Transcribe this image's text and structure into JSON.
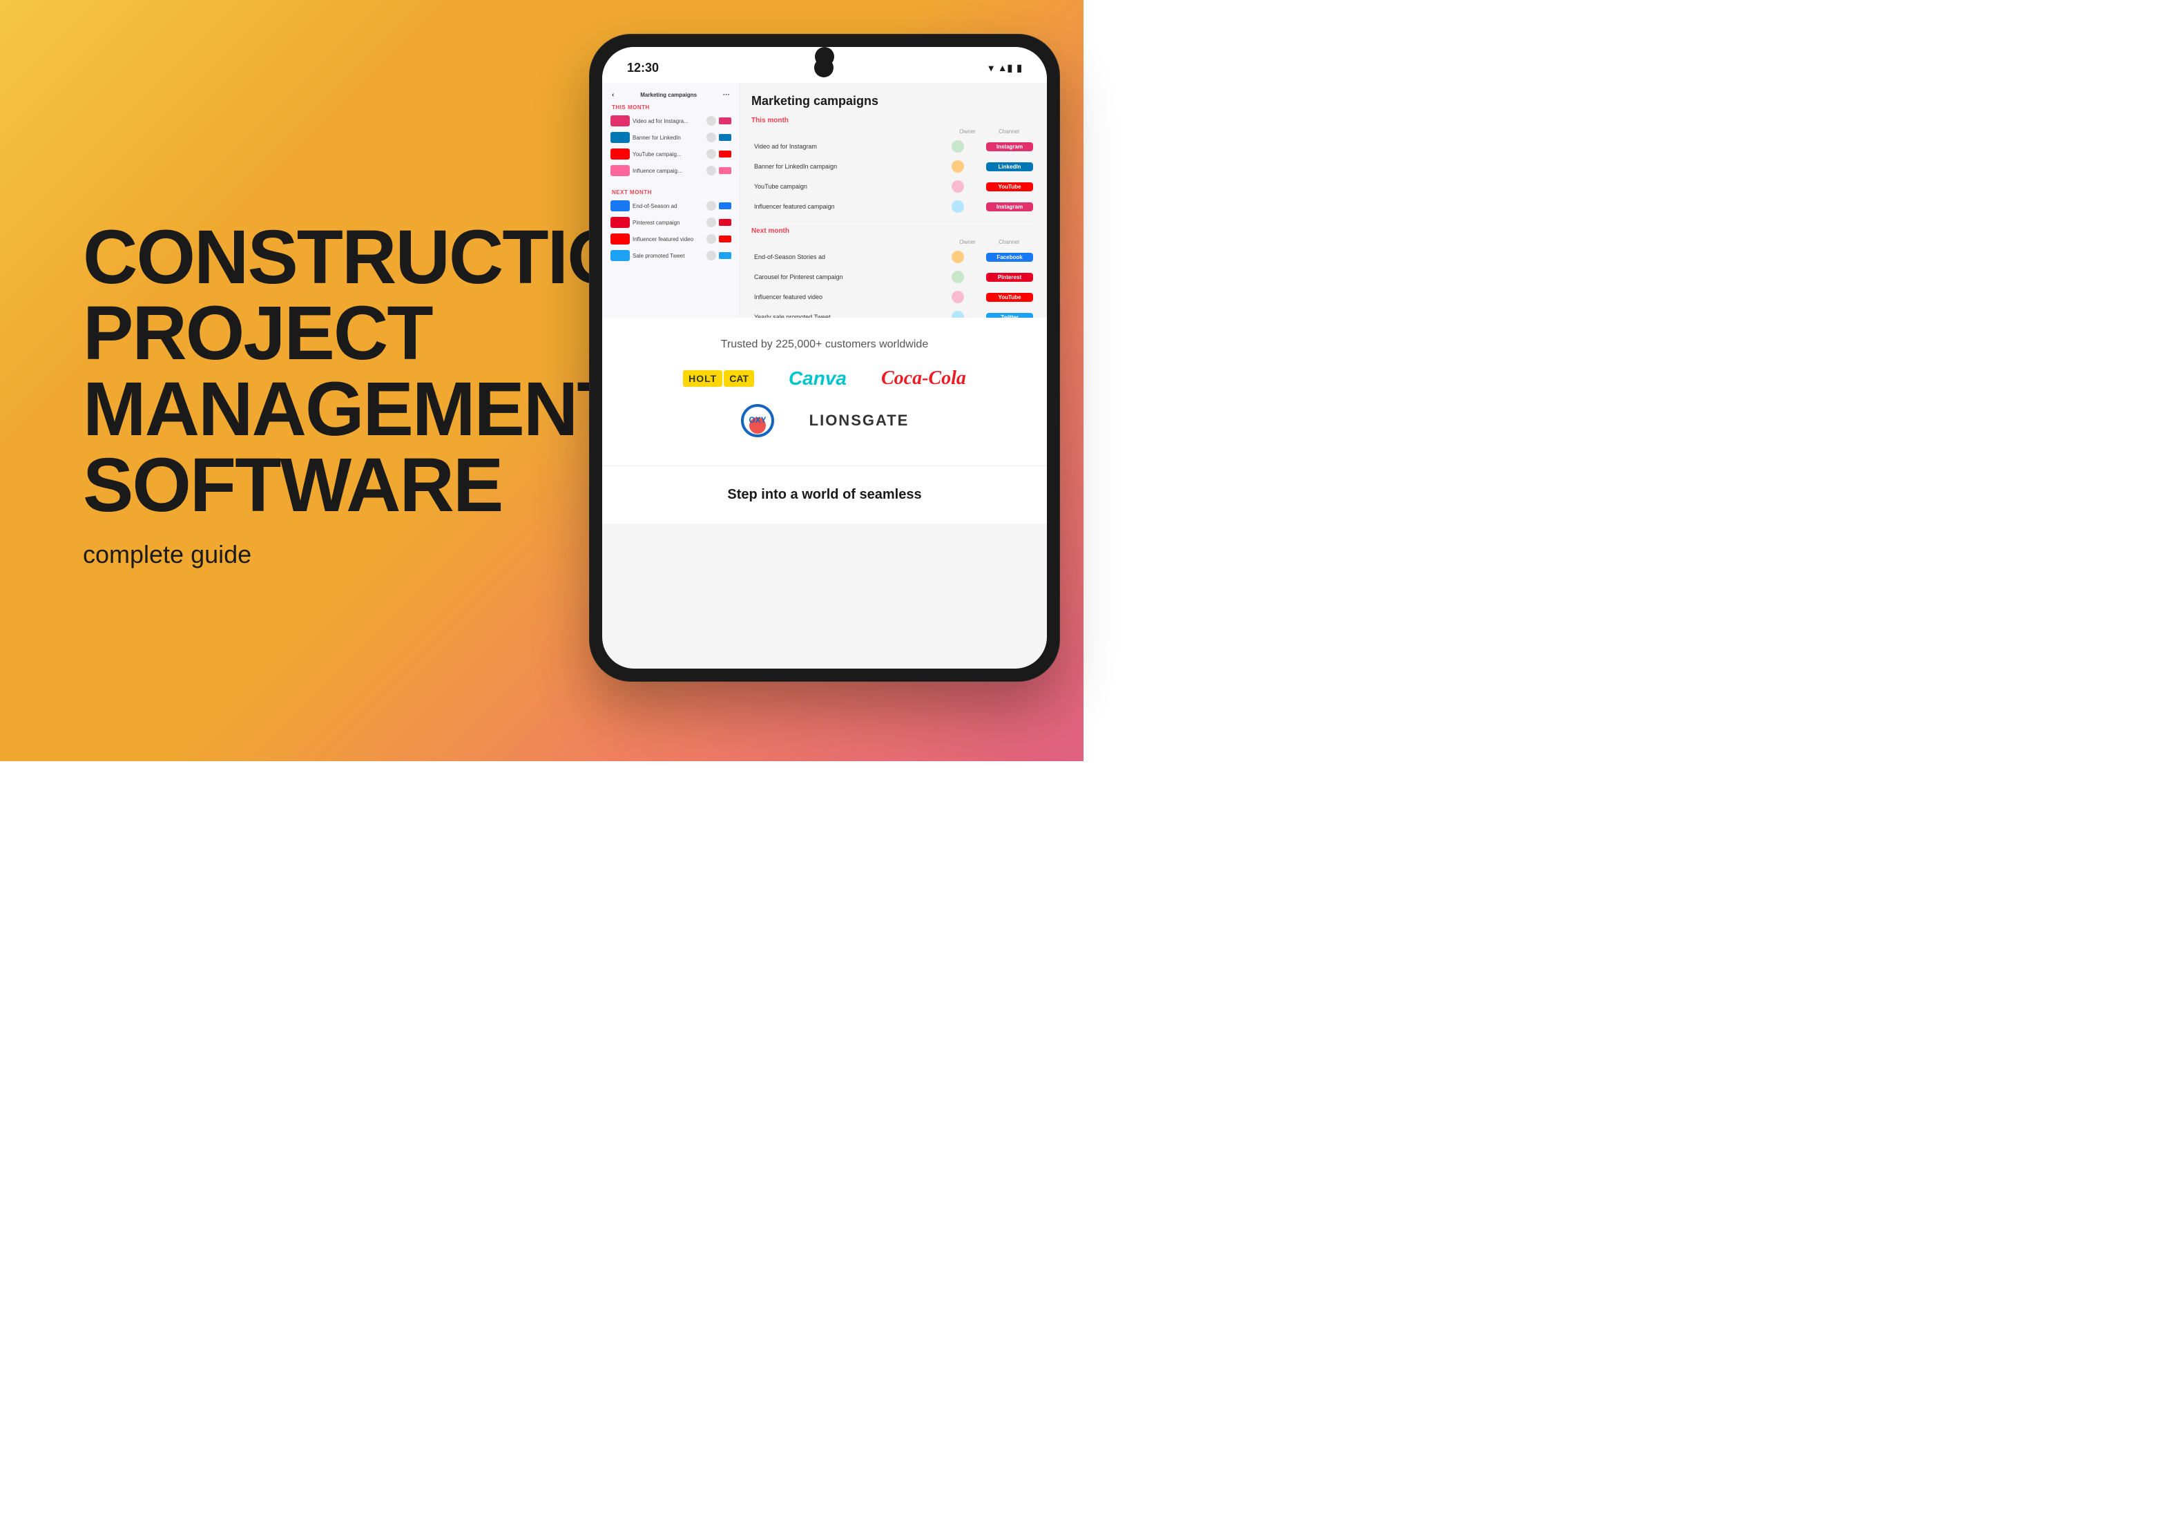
{
  "background": {
    "gradient_start": "#f5c842",
    "gradient_end": "#e06080"
  },
  "hero": {
    "title_line1": "CONSTRUCTION",
    "title_line2": "PROJECT",
    "title_line3": "MANAGEMENT",
    "title_line4": "SOFTWARE",
    "subtitle": "complete guide"
  },
  "phone": {
    "status_bar": {
      "time": "12:30",
      "icons": "▾◀▮"
    },
    "app": {
      "title": "Marketing campaigns",
      "this_month_label": "This month",
      "next_month_label": "Next month",
      "col_owner": "Owner",
      "col_channel": "Channel",
      "this_month_campaigns": [
        {
          "name": "Video ad for Instagram",
          "avatar": "a",
          "channel": "Instagram",
          "channel_class": "ch-instagram"
        },
        {
          "name": "Banner for LinkedIn campaign",
          "avatar": "b",
          "channel": "LinkedIn",
          "channel_class": "ch-linkedin"
        },
        {
          "name": "YouTube campaign",
          "avatar": "c",
          "channel": "YouTube",
          "channel_class": "ch-youtube"
        },
        {
          "name": "Influencer featured campaign",
          "avatar": "d",
          "channel": "Instagram",
          "channel_class": "ch-instagram"
        }
      ],
      "next_month_campaigns": [
        {
          "name": "End-of-Season Stories ad",
          "avatar": "b",
          "channel": "Facebook",
          "channel_class": "ch-facebook"
        },
        {
          "name": "Carousel for Pinterest campaign",
          "avatar": "a",
          "channel": "Pinterest",
          "channel_class": "ch-pinterest"
        },
        {
          "name": "Influencer featured video",
          "avatar": "c",
          "channel": "YouTube",
          "channel_class": "ch-youtube"
        },
        {
          "name": "Yearly sale promoted Tweet",
          "avatar": "d",
          "channel": "Twitter",
          "channel_class": "ch-twitter"
        }
      ]
    },
    "sidebar": {
      "header": "Marketing campaigns",
      "this_month_items": [
        {
          "text": "Video ad for Instagra...",
          "color": "#e1306c"
        },
        {
          "text": "Banner for LinkedIn",
          "color": "#0077b5"
        },
        {
          "text": "YouTube campaig...",
          "color": "#ff0000"
        },
        {
          "text": "Influence campaig...",
          "color": "#ff6699"
        }
      ],
      "next_month_items": [
        {
          "text": "End-of-Season ad",
          "color": "#1877f2"
        },
        {
          "text": "Pinterest campaign",
          "color": "#e60023"
        },
        {
          "text": "Influencer featured video",
          "color": "#ff0000"
        },
        {
          "text": "Sale promoted Tweet",
          "color": "#1da1f2"
        }
      ]
    },
    "trusted": {
      "title": "Trusted by 225,000+ customers worldwide",
      "logos": [
        "HOLT CAT",
        "Canva",
        "Coca-Cola",
        "OXY",
        "LIONSGATE"
      ]
    },
    "bottom": {
      "text": "Step into a world of seamless"
    }
  }
}
